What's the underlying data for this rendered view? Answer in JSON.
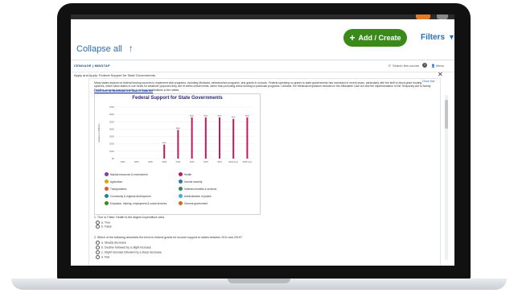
{
  "appbar": {
    "collapse_label": "Collapse all",
    "add_label": "Add / Create",
    "filters_label": "Filters"
  },
  "reader": {
    "brand": "CENGAGE | MINDTAP",
    "search_label": "Search this course",
    "menu_label": "Menu",
    "breadcrumb": "Apply and Apply: Federal Support for State Governments",
    "edit_label": "Close this"
  },
  "content": {
    "intro": "Many states depend on federal funding sources to implement vital programs, including Medicaid, infrastructure programs, and grants to schools. Federal spending on grants to state governments has increased in recent years, particularly with the shift to block grant funding systems, which allow states to use funds for whatever purposes they see fit within certain limits, rather than providing direct funding to particular programs. Likewise, the Medicaid expansion included in the Affordable Care Act and the implementation of the Temporary Aid to Needy Families program has led to shifts in federal contributions to the states.",
    "download_link": "Click here to download the source data file"
  },
  "chart_data": {
    "type": "bar",
    "title": "Federal Support for State Governments",
    "ylabel": "Dollars in Millions",
    "categories": [
      "2000",
      "2003",
      "2006",
      "2009",
      "2012",
      "2015",
      "2018",
      "2021",
      "2024 (est.)",
      "2025 (est.)"
    ],
    "values": [
      0,
      0,
      0,
      190,
      390,
      560,
      560,
      560,
      540,
      560
    ],
    "ylim": [
      0,
      700
    ],
    "bar_color": "#c2185b"
  },
  "legend": [
    {
      "label": "Natural resources & environment",
      "color": "#7e3ea2"
    },
    {
      "label": "Health",
      "color": "#c2185b"
    },
    {
      "label": "Agriculture",
      "color": "#e0a019"
    },
    {
      "label": "Income security",
      "color": "#2a7ab0"
    },
    {
      "label": "Transportation",
      "color": "#e05a2c"
    },
    {
      "label": "Veterans benefits & services",
      "color": "#2e8b57"
    },
    {
      "label": "Community & regional development",
      "color": "#1a8a8a"
    },
    {
      "label": "Administration of justice",
      "color": "#3bb0d0"
    },
    {
      "label": "Education, training, employment & social services",
      "color": "#3a8a1a"
    },
    {
      "label": "General government",
      "color": "#d2691e"
    }
  ],
  "question1": {
    "prompt": "1. True or False: Health is the largest expenditure area.",
    "options": [
      "a. True",
      "b. False"
    ]
  },
  "question2": {
    "prompt": "2. Which of the following describes the trend in federal grants for income support to states between 2011 and 2019?",
    "options": [
      "a. Steady decrease",
      "b. Decline followed by a slight increase",
      "c. Slight increase followed by a steep decrease",
      "d. Flat"
    ]
  }
}
